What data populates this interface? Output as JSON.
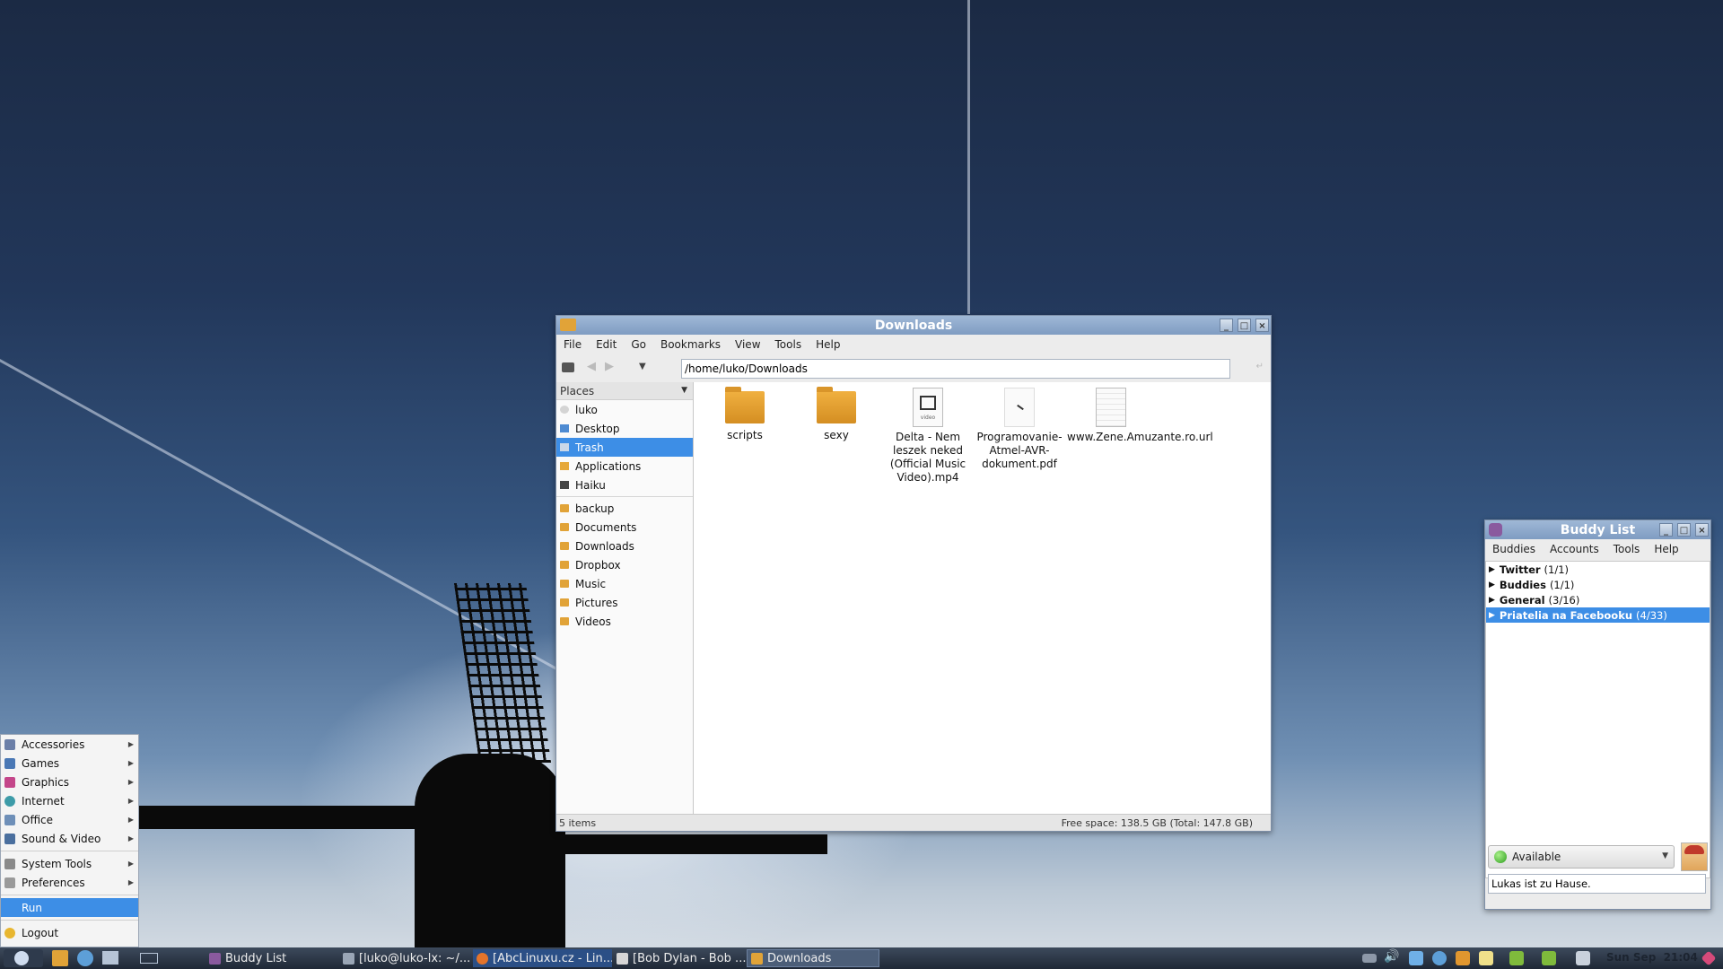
{
  "file_manager": {
    "title": "Downloads",
    "menu": [
      "File",
      "Edit",
      "Go",
      "Bookmarks",
      "View",
      "Tools",
      "Help"
    ],
    "path": "/home/luko/Downloads",
    "places_label": "Places",
    "places": [
      {
        "label": "luko",
        "icon": "home-icon"
      },
      {
        "label": "Desktop",
        "icon": "desktop-icon"
      },
      {
        "label": "Trash",
        "icon": "trash-icon",
        "selected": true
      },
      {
        "label": "Applications",
        "icon": "applications-icon"
      },
      {
        "label": "Haiku",
        "icon": "drive-icon"
      }
    ],
    "bookmarks": [
      "backup",
      "Documents",
      "Downloads",
      "Dropbox",
      "Music",
      "Pictures",
      "Videos"
    ],
    "files": [
      {
        "name": "scripts",
        "type": "folder"
      },
      {
        "name": "sexy",
        "type": "folder"
      },
      {
        "name": "Delta - Nem leszek neked (Official Music Video).mp4",
        "type": "video",
        "badge": "video"
      },
      {
        "name": "Programovanie-Atmel-AVR-dokument.pdf",
        "type": "pdf"
      },
      {
        "name": "www.Zene.Amuzante.ro.url",
        "type": "text"
      }
    ],
    "status_left": "5 items",
    "status_right": "Free space: 138.5 GB (Total: 147.8 GB)"
  },
  "buddy_list": {
    "title": "Buddy List",
    "menu": [
      "Buddies",
      "Accounts",
      "Tools",
      "Help"
    ],
    "groups": [
      {
        "name": "Twitter",
        "count": "(1/1)"
      },
      {
        "name": "Buddies",
        "count": "(1/1)"
      },
      {
        "name": "General",
        "count": "(3/16)"
      },
      {
        "name": "Priatelia na Facebooku",
        "count": "(4/33)",
        "selected": true
      }
    ],
    "status": "Available",
    "status_message": "Lukas ist zu Hause."
  },
  "start_menu": {
    "items": [
      {
        "label": "Accessories",
        "submenu": true,
        "color": "#6b7fa8"
      },
      {
        "label": "Games",
        "submenu": true,
        "color": "#4a78b5"
      },
      {
        "label": "Graphics",
        "submenu": true,
        "color": "#c4468a"
      },
      {
        "label": "Internet",
        "submenu": true,
        "color": "#3d9ba8"
      },
      {
        "label": "Office",
        "submenu": true,
        "color": "#6e8fb8"
      },
      {
        "label": "Sound & Video",
        "submenu": true,
        "color": "#4a6f9e"
      },
      {
        "label": "System Tools",
        "submenu": true,
        "color": "#8a8a8a"
      },
      {
        "label": "Preferences",
        "submenu": true,
        "color": "#9a9a9a"
      }
    ],
    "run_label": "Run",
    "logout_label": "Logout"
  },
  "taskbar": {
    "tasks": [
      {
        "label": "Buddy List",
        "icon": "pidgin-icon"
      },
      {
        "label": "[luko@luko-lx: ~/...",
        "icon": "terminal-icon"
      },
      {
        "label": "[AbcLinuxu.cz - Lin...",
        "icon": "firefox-icon"
      },
      {
        "label": "[Bob Dylan - Bob ...",
        "icon": "browser-icon"
      },
      {
        "label": "Downloads",
        "icon": "folder-icon",
        "active": true
      }
    ],
    "clock": "Sun Sep  21:04"
  }
}
